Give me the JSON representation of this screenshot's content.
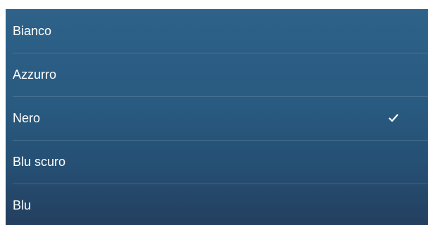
{
  "color_list": {
    "items": [
      {
        "label": "Bianco",
        "selected": false
      },
      {
        "label": "Azzurro",
        "selected": false
      },
      {
        "label": "Nero",
        "selected": true
      },
      {
        "label": "Blu scuro",
        "selected": false
      },
      {
        "label": "Blu",
        "selected": false
      }
    ],
    "selected_icon": "checkmark-icon",
    "text_color": "#ffffff",
    "background_top": "#2e6289",
    "background_bottom": "#243f5f"
  }
}
